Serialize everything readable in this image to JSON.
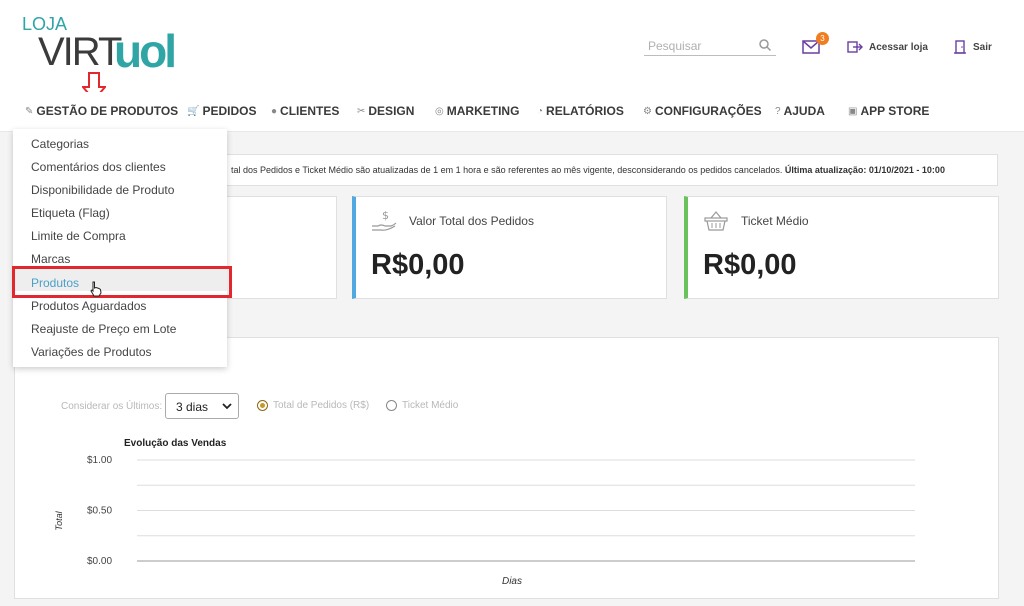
{
  "logo": {
    "top": "LOJA",
    "left": "VIRT",
    "right": "uol"
  },
  "header": {
    "search_placeholder": "Pesquisar",
    "mail_badge": "3",
    "acessar_label": "Acessar loja",
    "sair_label": "Sair"
  },
  "nav": {
    "items": [
      {
        "label": "GESTÃO DE PRODUTOS",
        "icon": "edit-icon"
      },
      {
        "label": "PEDIDOS",
        "icon": "cart-icon"
      },
      {
        "label": "CLIENTES",
        "icon": "user-icon"
      },
      {
        "label": "DESIGN",
        "icon": "design-icon"
      },
      {
        "label": "MARKETING",
        "icon": "target-icon"
      },
      {
        "label": "RELATÓRIOS",
        "icon": "pie-icon"
      },
      {
        "label": "CONFIGURAÇÕES",
        "icon": "gears-icon"
      },
      {
        "label": "AJUDA",
        "icon": "help-icon"
      },
      {
        "label": "APP STORE",
        "icon": "store-icon"
      }
    ]
  },
  "dropdown": {
    "items": [
      "Categorias",
      "Comentários dos clientes",
      "Disponibilidade de Produto",
      "Etiqueta (Flag)",
      "Limite de Compra",
      "Marcas",
      "Produtos",
      "Produtos Aguardados",
      "Reajuste de Preço em Lote",
      "Variações de Produtos"
    ],
    "active_index": 6
  },
  "info": {
    "text": "tal dos Pedidos e Ticket Médio são atualizadas de 1 em 1 hora e são referentes ao mês vigente, desconsiderando os pedidos cancelados.",
    "update_label": "Última atualização: 01/10/2021 - 10:00"
  },
  "cards": {
    "total_title": "Valor Total dos Pedidos",
    "total_value": "R$0,00",
    "ticket_title": "Ticket Médio",
    "ticket_value": "R$0,00",
    "accent_blue": "#52a8e0",
    "accent_green": "#69c25c"
  },
  "filters": {
    "consider_label": "Considerar os Últimos:",
    "select_value": "3 dias",
    "radio_total": "Total de Pedidos (R$)",
    "radio_ticket": "Ticket Médio"
  },
  "chart_data": {
    "type": "line",
    "title": "Evolução das Vendas",
    "xlabel": "Dias",
    "ylabel": "Total",
    "ylim": [
      0,
      1
    ],
    "yticks": [
      "$1.00",
      "$0.50",
      "$0.00"
    ],
    "x": [],
    "series": [],
    "grid": true
  }
}
